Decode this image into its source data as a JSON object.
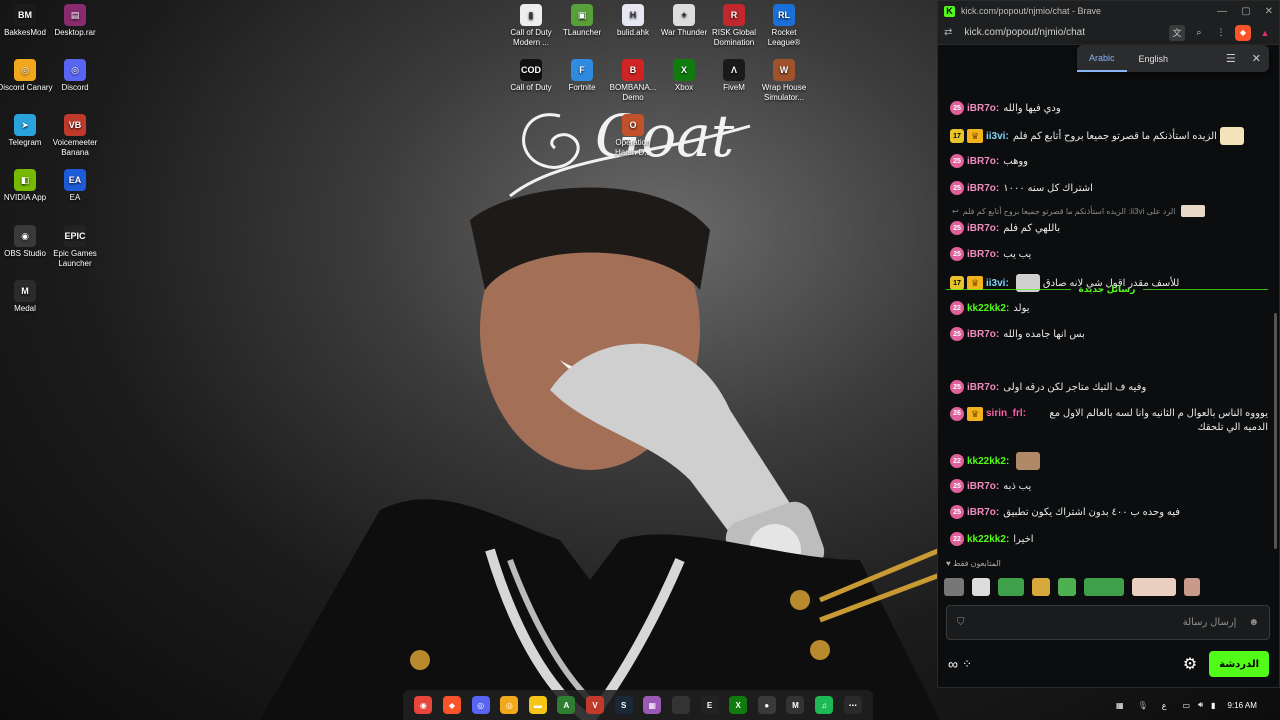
{
  "desktop": {
    "wallpaper_text": "Goat",
    "icons": [
      {
        "label": "BakkesMod",
        "color": "#1b1b1b",
        "glyph": "BM"
      },
      {
        "label": "Desktop.rar",
        "color": "#8a2b6f",
        "glyph": "▤"
      },
      {
        "label": "Discord Canary",
        "color": "#f2a81d",
        "glyph": "◎"
      },
      {
        "label": "Discord",
        "color": "#5865f2",
        "glyph": "◎"
      },
      {
        "label": "Telegram",
        "color": "#2aa3dd",
        "glyph": "➤"
      },
      {
        "label": "Voicemeeter Banana",
        "color": "#c0392b",
        "glyph": "VB"
      },
      {
        "label": "NVIDIA App",
        "color": "#76b900",
        "glyph": "◧"
      },
      {
        "label": "EA",
        "color": "#1e5bd8",
        "glyph": "EA"
      },
      {
        "label": "OBS Studio",
        "color": "#3a3a3a",
        "glyph": "◉"
      },
      {
        "label": "Epic Games Launcher",
        "color": "#222",
        "glyph": "EPIC"
      },
      {
        "label": "Medal",
        "color": "#2b2b2b",
        "glyph": "M"
      },
      {
        "label": "Call of Duty Modern ...",
        "color": "#eeeeee",
        "glyph": "▮"
      },
      {
        "label": "TLauncher",
        "color": "#5aa03a",
        "glyph": "▣"
      },
      {
        "label": "bulid.ahk",
        "color": "#e8e8f5",
        "glyph": "H"
      },
      {
        "label": "War Thunder",
        "color": "#dddddd",
        "glyph": "✦"
      },
      {
        "label": "RISK Global Domination",
        "color": "#c0282d",
        "glyph": "R"
      },
      {
        "label": "Rocket League®",
        "color": "#1a6fd8",
        "glyph": "RL"
      },
      {
        "label": "Call of Duty",
        "color": "#111",
        "glyph": "COD"
      },
      {
        "label": "Fortnite",
        "color": "#2e8be0",
        "glyph": "F"
      },
      {
        "label": "BOMBANA... Demo",
        "color": "#d02424",
        "glyph": "B"
      },
      {
        "label": "Xbox",
        "color": "#107c10",
        "glyph": "X"
      },
      {
        "label": "FiveM",
        "color": "#1a1a1a",
        "glyph": "Λ"
      },
      {
        "label": "Wrap House Simulator...",
        "color": "#a0522d",
        "glyph": "W"
      },
      {
        "label": "Operation Harsh D...",
        "color": "#c0512a",
        "glyph": "O"
      }
    ]
  },
  "taskbar": {
    "apps": [
      {
        "name": "chrome-icon",
        "color": "#e8453c",
        "glyph": "◉"
      },
      {
        "name": "brave-icon",
        "color": "#fb542b",
        "glyph": "◆"
      },
      {
        "name": "discord-icon",
        "color": "#5865f2",
        "glyph": "◎"
      },
      {
        "name": "discord-canary-icon",
        "color": "#f2a81d",
        "glyph": "◎"
      },
      {
        "name": "file-explorer-icon",
        "color": "#f5c518",
        "glyph": "▬"
      },
      {
        "name": "app-a-icon",
        "color": "#2e7d32",
        "glyph": "A"
      },
      {
        "name": "voicemeeter-icon",
        "color": "#c0392b",
        "glyph": "V"
      },
      {
        "name": "steam-icon",
        "color": "#1b2838",
        "glyph": "S"
      },
      {
        "name": "app-grid-icon",
        "color": "#9b59b6",
        "glyph": "▦"
      },
      {
        "name": "app-blank-icon",
        "color": "#333",
        "glyph": ""
      },
      {
        "name": "epic-icon",
        "color": "#222",
        "glyph": "E"
      },
      {
        "name": "xbox-icon",
        "color": "#107c10",
        "glyph": "X"
      },
      {
        "name": "obs-icon",
        "color": "#3a3a3a",
        "glyph": "●"
      },
      {
        "name": "medal-icon",
        "color": "#333",
        "glyph": "M"
      },
      {
        "name": "spotify-icon",
        "color": "#1db954",
        "glyph": "♫"
      },
      {
        "name": "app-dots-icon",
        "color": "#2a2a2a",
        "glyph": "⋯"
      }
    ],
    "lang": "ع",
    "time": "9:16 AM"
  },
  "browser": {
    "title": "kick.com/popout/njmio/chat - Brave",
    "url": "kick.com/popout/njmio/chat",
    "translate": {
      "from": "Arabic",
      "to": "English"
    }
  },
  "chat": {
    "messages": [
      {
        "badge": "25",
        "user": "iBR7o",
        "color": "#f08cc0",
        "text": "ودي فيها والله"
      },
      {
        "badge": "17",
        "gold": true,
        "crown": true,
        "user": "ii3vi",
        "color": "#7fd6ff",
        "text": "الزيده استأذنكم ما قصرتو جميعا بروح أتابع كم فلم",
        "emote_after": true
      },
      {
        "badge": "25",
        "user": "iBR7o",
        "color": "#f08cc0",
        "text": "ووهب"
      },
      {
        "badge": "25",
        "user": "iBR7o",
        "color": "#f08cc0",
        "text": "اشتراك كل سنه ١٠٠٠"
      },
      {
        "badge": "25",
        "user": "iBR7o",
        "color": "#f08cc0",
        "text": "باللهي كم فلم"
      },
      {
        "badge": "25",
        "user": "iBR7o",
        "color": "#f08cc0",
        "text": "يب يب"
      },
      {
        "badge": "17",
        "gold": true,
        "crown": true,
        "user": "ii3vi",
        "color": "#7fd6ff",
        "text": "للأسف مقدر اقول شي لانه صادق",
        "emote_before": true
      },
      {
        "badge": "22",
        "user": "kk22kk2",
        "color": "#53fc18",
        "text": "يولد"
      },
      {
        "badge": "25",
        "user": "iBR7o",
        "color": "#f08cc0",
        "text": "بس انها جامده والله"
      },
      {
        "badge": "25",
        "user": "iBR7o",
        "color": "#f08cc0",
        "text": "وفيه ف التيك متاجر لكن درقه اولى"
      },
      {
        "badge": "26",
        "crown": true,
        "user": "sirin_frl",
        "color": "#ff5ea8",
        "text": "يوووه الناس بالعوال م الثانيه وانا لسه بالعالم الاول مع الدميه الي تلحقك"
      },
      {
        "badge": "22",
        "user": "kk22kk2",
        "color": "#53fc18",
        "text": "",
        "emote_after": true
      },
      {
        "badge": "25",
        "user": "iBR7o",
        "color": "#f08cc0",
        "text": "يب ذبه"
      },
      {
        "badge": "25",
        "user": "iBR7o",
        "color": "#f08cc0",
        "text": "فيه وحده ب ٤٠٠ بدون اشتراك يكون تطبيق"
      },
      {
        "badge": "22",
        "user": "kk22kk2",
        "color": "#53fc18",
        "text": "اخيرا"
      }
    ],
    "reply_preview": "الرد على ii3vi: الزيده استأذنكم ما قصرتو جميعا بروح أتابع كم فلم",
    "new_messages_label": "رسائل جديدة",
    "followers_only": "المتابعون فقط",
    "input_placeholder": "إرسال رسالة",
    "send_label": "الدردشة"
  }
}
